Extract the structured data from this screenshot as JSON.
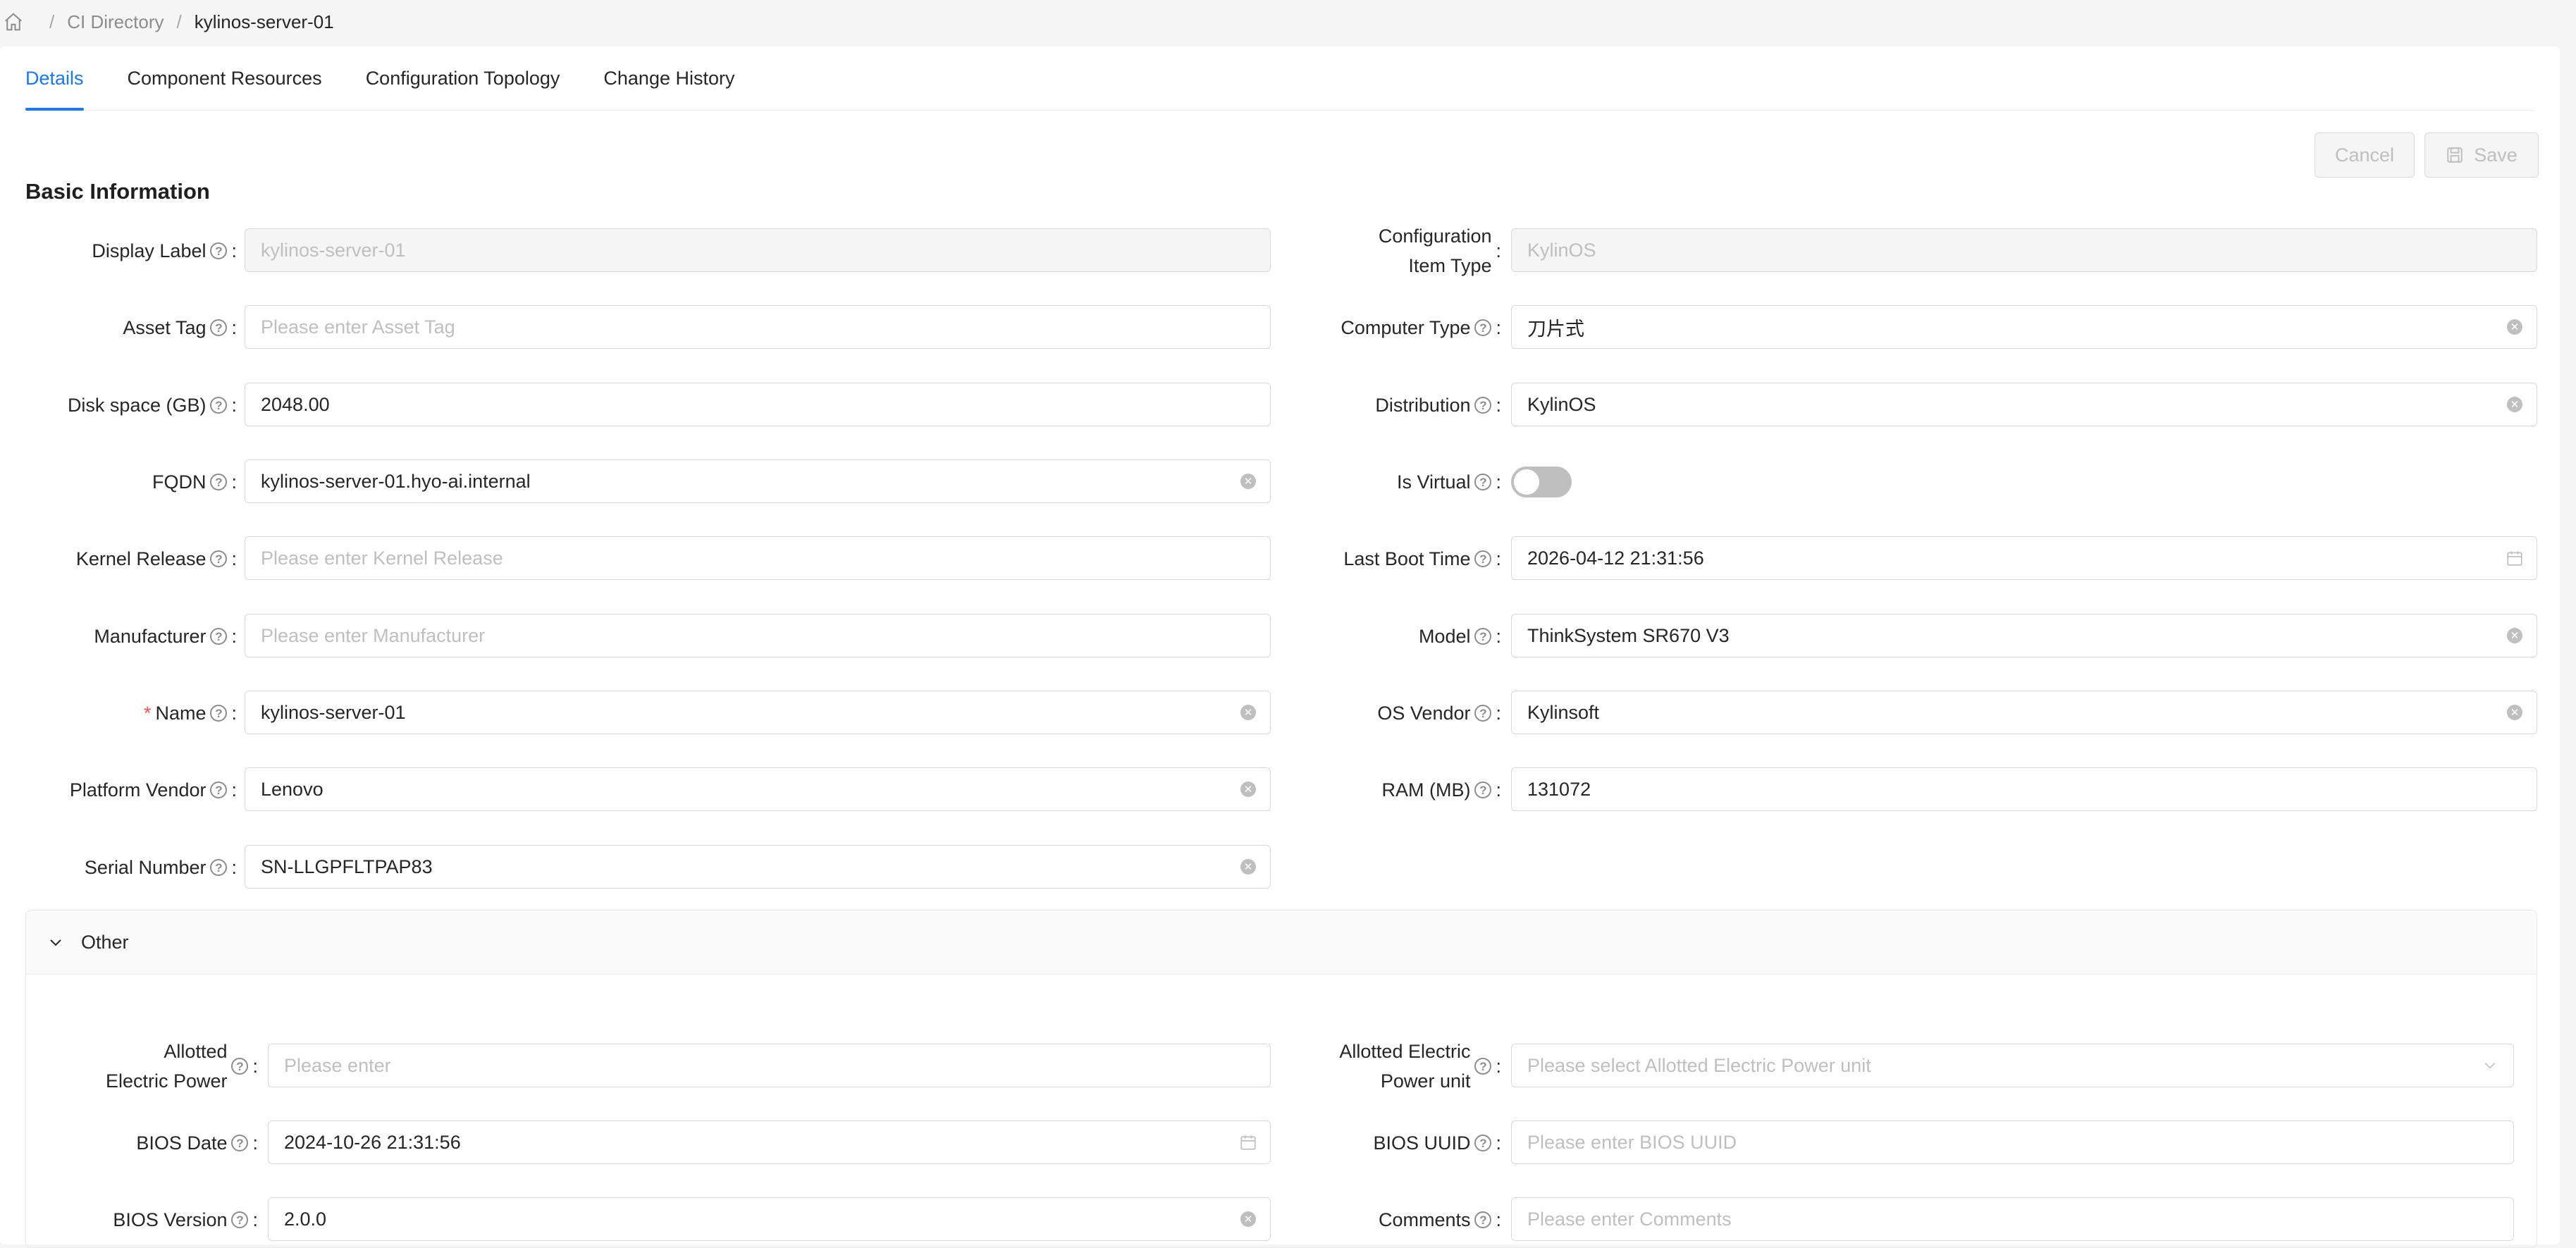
{
  "breadcrumb": {
    "items": [
      "CI Directory",
      "kylinos-server-01"
    ]
  },
  "tabs": [
    "Details",
    "Component Resources",
    "Configuration Topology",
    "Change History"
  ],
  "actions": {
    "cancel": "Cancel",
    "save": "Save"
  },
  "basic": {
    "title": "Basic Information",
    "display_label": {
      "label": "Display Label",
      "value": "kylinos-server-01"
    },
    "ci_type": {
      "label_line1": "Configuration",
      "label_line2": "Item Type",
      "value": "KylinOS"
    },
    "asset_tag": {
      "label": "Asset Tag",
      "placeholder": "Please enter Asset Tag"
    },
    "computer_type": {
      "label": "Computer Type",
      "value": "刀片式"
    },
    "disk_space": {
      "label": "Disk space (GB)",
      "value": "2048.00"
    },
    "distribution": {
      "label": "Distribution",
      "value": "KylinOS"
    },
    "fqdn": {
      "label": "FQDN",
      "value": "kylinos-server-01.hyo-ai.internal"
    },
    "is_virtual": {
      "label": "Is Virtual",
      "checked": false
    },
    "kernel_release": {
      "label": "Kernel Release",
      "placeholder": "Please enter Kernel Release"
    },
    "last_boot_time": {
      "label": "Last Boot Time",
      "value": "2026-04-12 21:31:56"
    },
    "manufacturer": {
      "label": "Manufacturer",
      "placeholder": "Please enter Manufacturer"
    },
    "model": {
      "label": "Model",
      "value": "ThinkSystem SR670 V3"
    },
    "name": {
      "label": "Name",
      "required_mark": "*",
      "value": "kylinos-server-01"
    },
    "os_vendor": {
      "label": "OS Vendor",
      "value": "Kylinsoft"
    },
    "platform_vendor": {
      "label": "Platform Vendor",
      "value": "Lenovo"
    },
    "ram": {
      "label": "RAM (MB)",
      "value": "131072"
    },
    "serial_number": {
      "label": "Serial Number",
      "value": "SN-LLGPFLTPAP83"
    }
  },
  "other": {
    "title": "Other",
    "allotted_power": {
      "label_line1": "Allotted",
      "label_line2": "Electric Power",
      "placeholder": "Please enter"
    },
    "allotted_power_unit": {
      "label_line1": "Allotted Electric",
      "label_line2": "Power unit",
      "placeholder": "Please select Allotted Electric Power unit"
    },
    "bios_date": {
      "label": "BIOS Date",
      "value": "2024-10-26 21:31:56"
    },
    "bios_uuid": {
      "label": "BIOS UUID",
      "placeholder": "Please enter BIOS UUID"
    },
    "bios_version": {
      "label": "BIOS Version",
      "value": "2.0.0"
    },
    "comments": {
      "label": "Comments",
      "placeholder": "Please enter Comments"
    }
  },
  "colors": {
    "primary": "#1677ff",
    "required": "#ff4d4f"
  },
  "icons": {
    "home": "home-icon",
    "help": "question-circle-icon",
    "clear": "close-circle-icon",
    "calendar": "calendar-icon",
    "save": "save-icon",
    "collapse": "chevron-down-icon"
  }
}
